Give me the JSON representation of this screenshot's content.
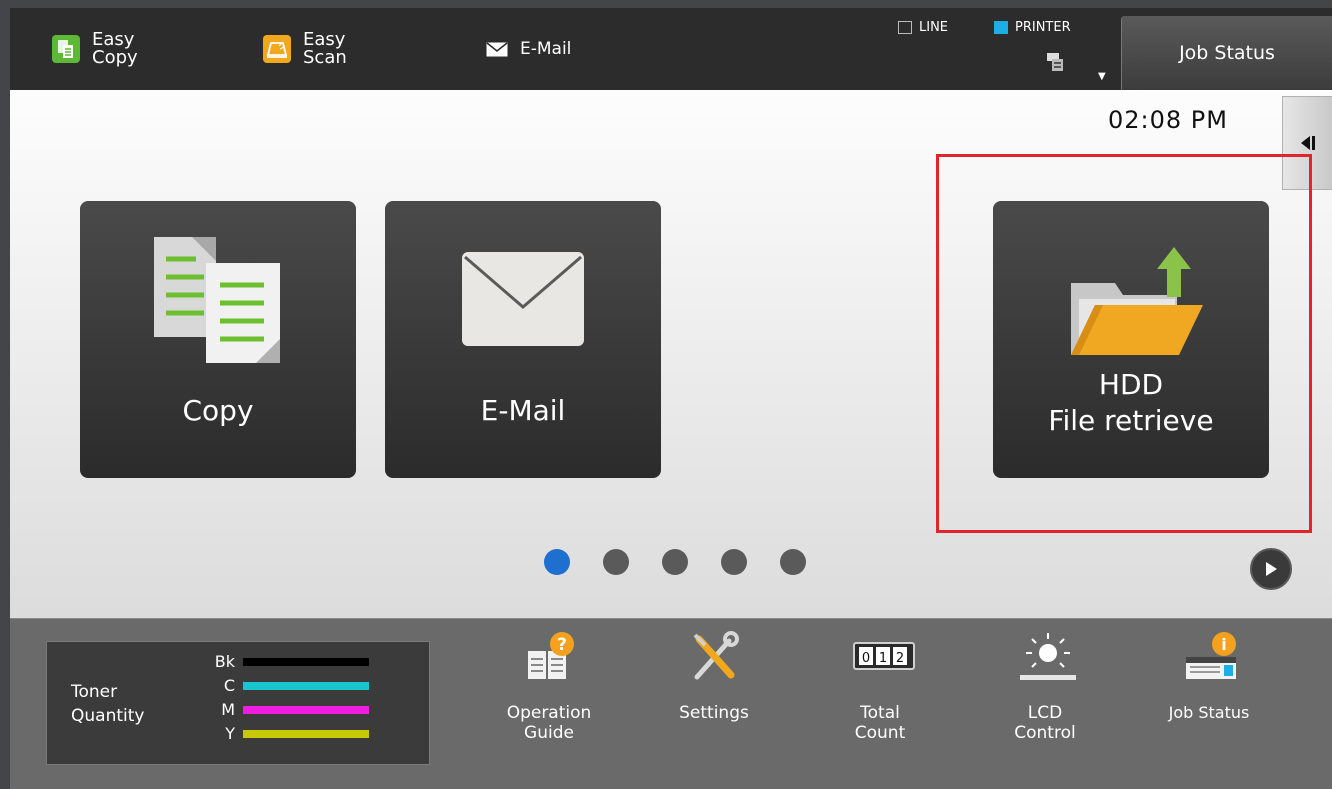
{
  "topbar": {
    "easy_copy": {
      "line1": "Easy",
      "line2": "Copy"
    },
    "easy_scan": {
      "line1": "Easy",
      "line2": "Scan"
    },
    "email": "E-Mail",
    "line_indicator": "LINE",
    "printer_indicator": "PRINTER",
    "job_status": "Job Status"
  },
  "main": {
    "clock": "02:08 PM",
    "tiles": {
      "copy": "Copy",
      "email": "E-Mail",
      "hdd_line1": "HDD",
      "hdd_line2": "File retrieve"
    },
    "page_count": 5,
    "current_page": 1
  },
  "bottombar": {
    "toner": {
      "title_line1": "Toner",
      "title_line2": "Quantity",
      "levels": [
        {
          "label": "Bk",
          "color": "#000000"
        },
        {
          "label": "C",
          "color": "#19c6cf"
        },
        {
          "label": "M",
          "color": "#ee1ee0"
        },
        {
          "label": "Y",
          "color": "#c8c80a"
        }
      ]
    },
    "operation_guide": {
      "line1": "Operation",
      "line2": "Guide"
    },
    "settings": "Settings",
    "total_count": {
      "line1": "Total",
      "line2": "Count"
    },
    "lcd_control": {
      "line1": "LCD",
      "line2": "Control"
    },
    "job_status": "Job Status"
  },
  "colors": {
    "highlight": "#e0262c",
    "active_dot": "#1f6fd1",
    "printer_indicator": "#1eaee6"
  },
  "icons": [
    "easy-copy-icon",
    "easy-scan-icon",
    "mail-icon",
    "printer-icon",
    "collapse-arrow-icon",
    "copy-documents-icon",
    "envelope-icon",
    "folder-upload-icon",
    "play-arrow-icon",
    "operation-guide-icon",
    "settings-tools-icon",
    "counter-icon",
    "brightness-icon",
    "job-status-icon"
  ]
}
